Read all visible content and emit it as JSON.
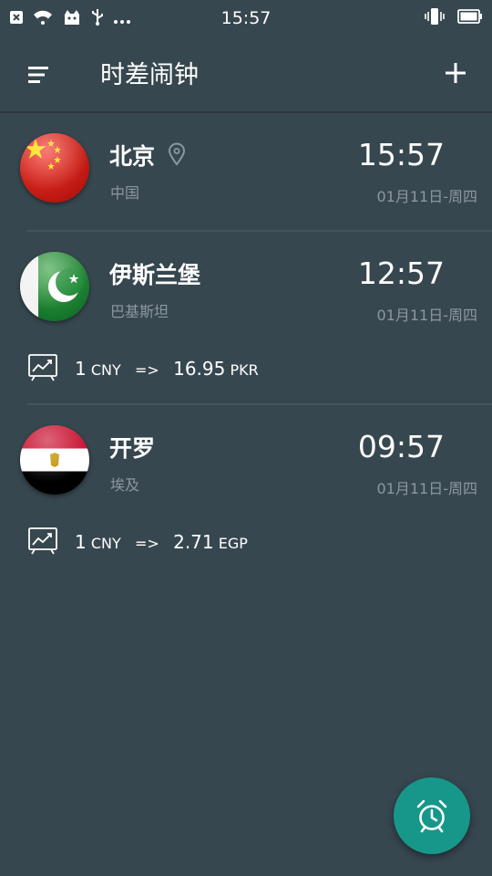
{
  "status_bar": {
    "time": "15:57",
    "left_icons": [
      "close-box-icon",
      "wifi-icon",
      "android-icon",
      "usb-icon",
      "more-dots-icon"
    ],
    "right_icons": [
      "vibrate-icon",
      "battery-icon"
    ]
  },
  "toolbar": {
    "title": "时差闹钟",
    "menu_icon": "menu-icon",
    "add_icon": "plus-icon"
  },
  "cities": [
    {
      "name": "北京",
      "country": "中国",
      "time": "15:57",
      "date": "01月11日-周四",
      "flag": "china-flag",
      "is_current_location": true
    },
    {
      "name": "伊斯兰堡",
      "country": "巴基斯坦",
      "time": "12:57",
      "date": "01月11日-周四",
      "flag": "pakistan-flag",
      "rate": {
        "amount": "1",
        "from": "CNY",
        "arrow": "=>",
        "value": "16.95",
        "to": "PKR"
      }
    },
    {
      "name": "开罗",
      "country": "埃及",
      "time": "09:57",
      "date": "01月11日-周四",
      "flag": "egypt-flag",
      "rate": {
        "amount": "1",
        "from": "CNY",
        "arrow": "=>",
        "value": "2.71",
        "to": "EGP"
      }
    }
  ],
  "fab": {
    "icon": "alarm-clock-icon"
  },
  "colors": {
    "background": "#37474f",
    "secondary_text": "#8c989f",
    "fab": "#17978a"
  }
}
